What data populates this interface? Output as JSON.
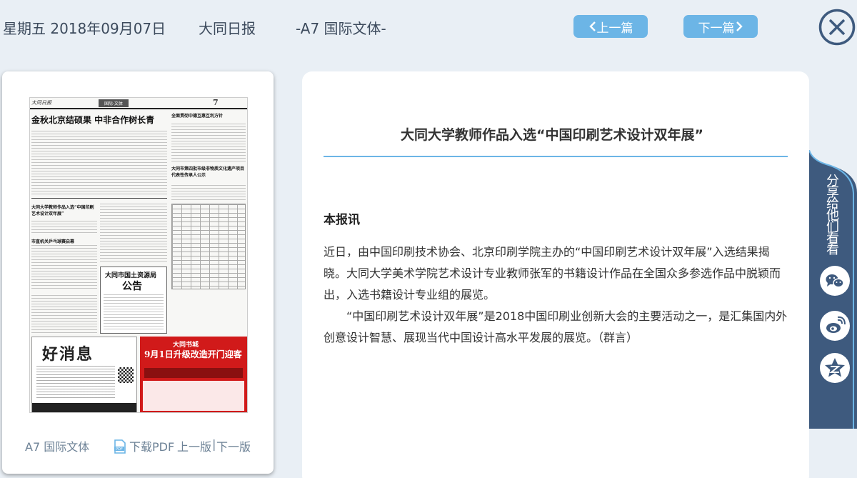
{
  "header": {
    "date": "星期五 2018年09月07日",
    "paper_name": "大同日报",
    "page_label": "-A7 国际文体-",
    "prev_label": "上一篇",
    "next_label": "下一篇",
    "close_icon": "close-circle-icon"
  },
  "newspaper": {
    "masthead": "大同日报",
    "section": "国际·文体",
    "page_no": "7",
    "headlines": [
      "金秋北京结硕果  中非合作树长青",
      "全面贯彻中德互惠互利方针",
      "大同市第四批市级非物质文化遗产项目代表性传承人公示",
      "大同大学教师作品入选“中国印刷艺术设计双年展”",
      "市直机关乒乓球赛启幕",
      "大同市国土资源局",
      "公告",
      "好消息",
      "大同书城",
      "9月1日升级改造开门迎客"
    ]
  },
  "paper_footer": {
    "page": "A7 国际文体",
    "pdf_icon": "pdf-file-icon",
    "download_pdf": "下载PDF",
    "prev_page": "上一版",
    "separator": "|",
    "next_page": "下一版"
  },
  "article": {
    "title": "大同大学教师作品入选“中国印刷艺术设计双年展”",
    "lead": "本报讯",
    "paragraphs": [
      "近日，由中国印刷技术协会、北京印刷学院主办的“中国印刷艺术设计双年展”入选结果揭晓。大同大学美术学院艺术设计专业教师张军的书籍设计作品在全国众多参选作品中脱颖而出，入选书籍设计专业组的展览。",
      "“中国印刷艺术设计双年展”是2018中国印刷业创新大会的主要活动之一，是汇集国内外创意设计智慧、展现当代中国设计高水平发展的展览。（群言）"
    ]
  },
  "share": {
    "label": "分享给他们看看",
    "buttons": [
      "wechat-icon",
      "weibo-icon",
      "qzone-icon"
    ]
  },
  "colors": {
    "accent": "#6cb5e6",
    "share_tab": "#3e5a7e",
    "background": "#e9eff5"
  }
}
